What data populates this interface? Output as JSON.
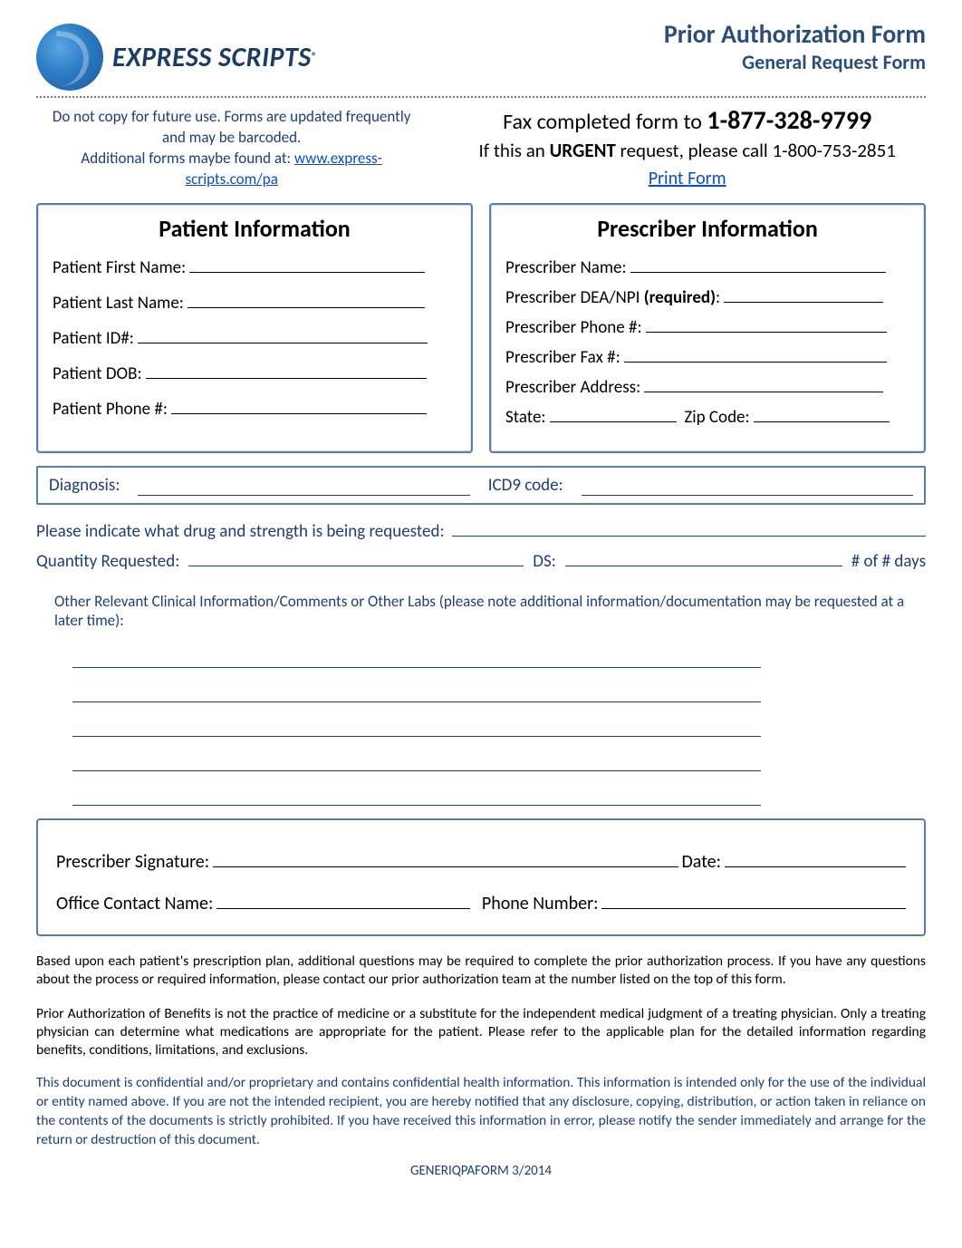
{
  "header": {
    "brand": "EXPRESS SCRIPTS",
    "reg": "®",
    "title_line1": "Prior Authorization Form",
    "title_line2": "General Request Form"
  },
  "top_notes": {
    "left_line1": "Do not copy for future use. Forms are updated frequently and may be barcoded.",
    "left_line2_prefix": "Additional forms maybe found at:",
    "left_link_text": "www.express-scripts.com/pa",
    "right_line1_prefix": "Fax completed form to ",
    "right_fax": "1-877-328-9799",
    "right_line2_prefix": "If this an ",
    "right_urgent": "URGENT",
    "right_line2_suffix": " request, please call 1-800-753-2851",
    "right_link": "Print Form"
  },
  "patient": {
    "heading": "Patient Information",
    "first_name_label": "Patient First Name:",
    "last_name_label": "Patient Last Name:",
    "id_label": "Patient ID#:",
    "dob_label": "Patient DOB:",
    "phone_label": "Patient Phone #:"
  },
  "prescriber": {
    "heading": "Prescriber Information",
    "name_label": "Prescriber Name:",
    "dea_label_prefix": "Prescriber DEA/NPI ",
    "dea_required": "(required)",
    "dea_colon": ":",
    "phone_label": "Prescriber Phone #:",
    "fax_label": "Prescriber Fax #:",
    "address_label": "Prescriber Address:",
    "state_label": "State:",
    "zip_label": "Zip Code:"
  },
  "dx_row": {
    "diagnosis_label": "Diagnosis:",
    "icd_label": "ICD9 code:"
  },
  "drug_line": {
    "label": "Please indicate what drug and strength is being requested:"
  },
  "qty_row": {
    "qty_label": "Quantity Requested:",
    "ds_label": "DS:",
    "days_label": "# of # days"
  },
  "clinical": {
    "label": "Other Relevant Clinical Information/Comments or Other Labs (please note additional information/documentation may be requested at a later time):"
  },
  "signature": {
    "sig_label": "Prescriber Signature:",
    "date_label": "Date:",
    "contact_label": "Office Contact Name:",
    "phone_label": "Phone Number:"
  },
  "footer": {
    "p1": "Based upon each patient's prescription plan, additional questions may be required to complete the prior authorization process.  If you have any questions about the process or required information, please contact our prior authorization team at the number listed on the top of this form.",
    "p2": "Prior Authorization of Benefits is not the practice of medicine or a substitute for the independent medical judgment of a treating physician.  Only a treating physician can determine what medications are appropriate for the patient.  Please refer to the applicable plan for the detailed information regarding benefits, conditions, limitations, and exclusions.",
    "conf": "This document is confidential and/or proprietary and contains confidential health information.  This information is intended only for the use of the individual or entity named above.  If you are not the intended recipient, you are hereby notified that any disclosure, copying, distribution, or action taken in reliance on the contents of the documents is strictly prohibited.  If you have received this information in error, please notify the sender immediately and arrange for the return or destruction of this document.",
    "id": "GENERIQPAFORM 3/2014"
  }
}
